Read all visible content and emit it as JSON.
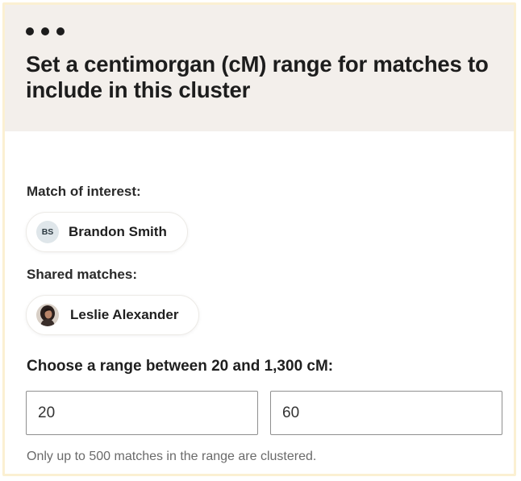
{
  "header": {
    "menu_icon": "more-horizontal-icon",
    "title": "Set a centimorgan (cM) range for matches to include in this cluster"
  },
  "match_of_interest": {
    "label": "Match of interest:",
    "person": {
      "initials": "BS",
      "name": "Brandon Smith"
    }
  },
  "shared_matches": {
    "label": "Shared matches:",
    "people": [
      {
        "name": "Leslie Alexander",
        "avatar": "profile-photo"
      }
    ]
  },
  "range": {
    "label": "Choose a range between 20 and 1,300 cM:",
    "min_value": "20",
    "max_value": "60",
    "hint": "Only up to 500 matches in the range are clustered."
  },
  "colors": {
    "header_bg": "#f3efeb",
    "panel_border": "#fbf0d2",
    "initials_avatar_bg": "#dfe6ea"
  }
}
